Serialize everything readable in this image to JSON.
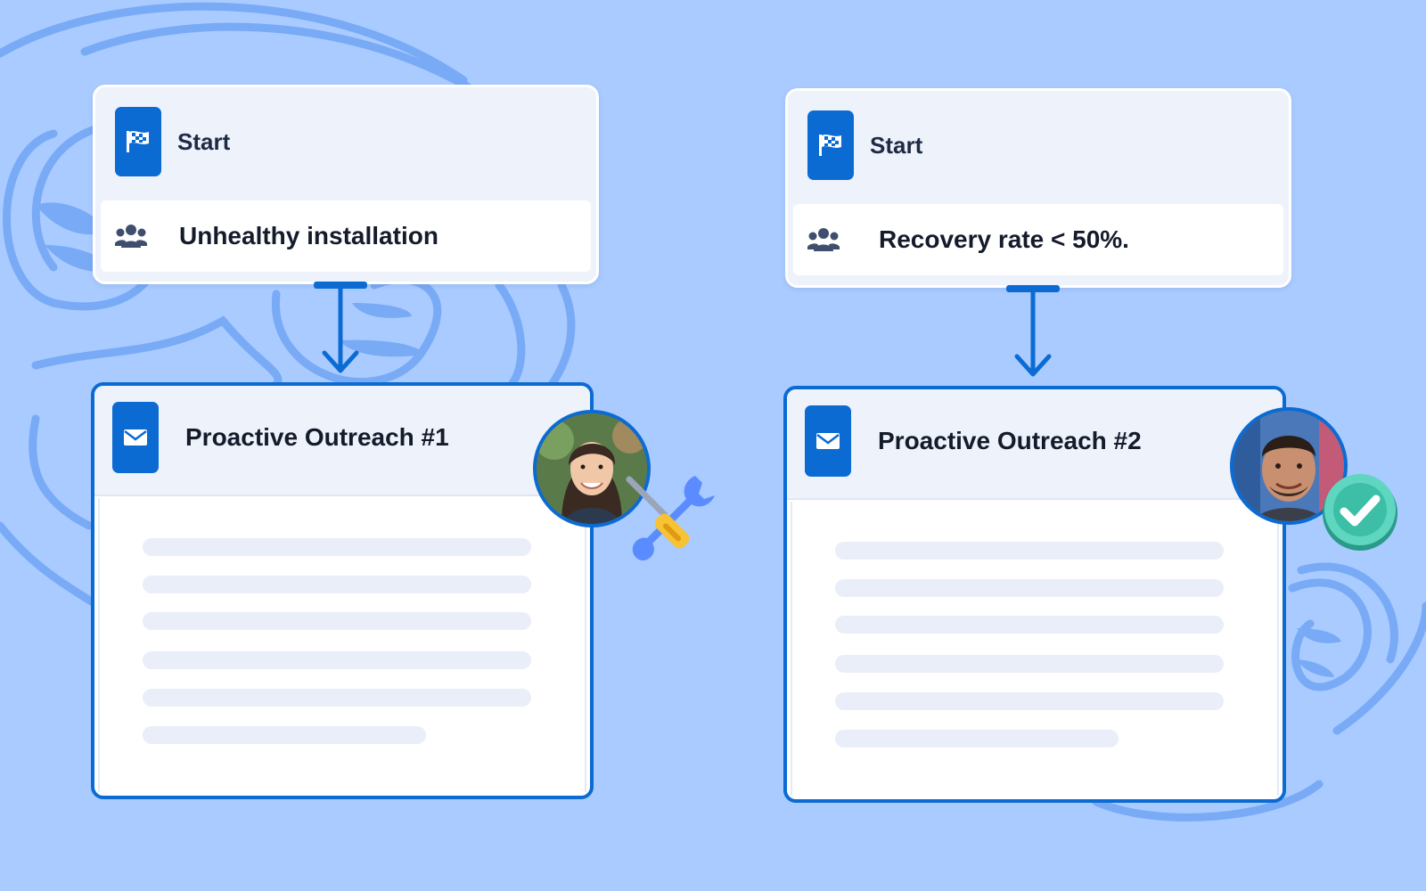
{
  "colors": {
    "background": "#a9cbff",
    "accent": "#0b6bd3",
    "card": "#eef2fa",
    "skeleton": "#e9eef8"
  },
  "workflows": [
    {
      "trigger": {
        "icon": "checkered-flag-icon",
        "label": "Start",
        "segment_icon": "users-group-icon",
        "segment": "Unhealthy installation"
      },
      "action": {
        "icon": "envelope-icon",
        "title": "Proactive Outreach #1",
        "assignee": "woman-avatar",
        "status_icon": "wrench-screwdriver-icon"
      }
    },
    {
      "trigger": {
        "icon": "checkered-flag-icon",
        "label": "Start",
        "segment_icon": "users-group-icon",
        "segment": "Recovery rate < 50%."
      },
      "action": {
        "icon": "envelope-icon",
        "title": "Proactive Outreach #2",
        "assignee": "man-avatar",
        "status_icon": "green-checkmark-icon"
      }
    }
  ]
}
